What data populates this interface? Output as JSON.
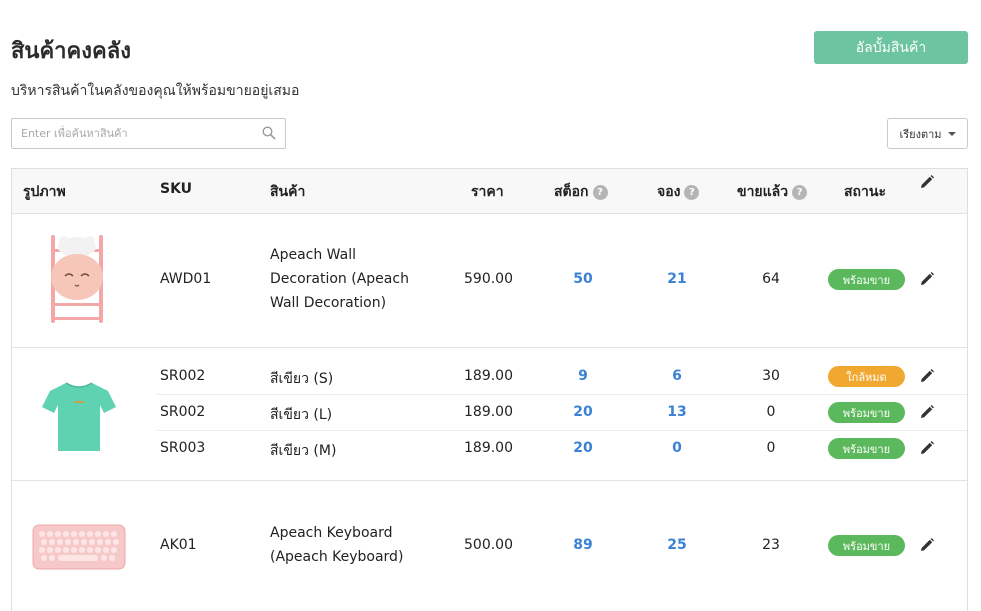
{
  "header": {
    "title": "สินค้าคงคลัง",
    "subtitle": "บริหารสินค้าในคลังของคุณให้พร้อมขายอยู่เสมอ",
    "upload_label": "อัลบั้มสินค้า"
  },
  "search": {
    "placeholder": "Enter เพื่อค้นหาสินค้า",
    "value": ""
  },
  "sort": {
    "label": "เรียงตาม"
  },
  "colors": {
    "accent": "#6cc4a1",
    "link_blue": "#3b82d6",
    "ready": "#5cb85c",
    "low": "#f0a830"
  },
  "table": {
    "columns": {
      "image": "รูปภาพ",
      "sku": "SKU",
      "product": "สินค้า",
      "price": "ราคา",
      "stock": "สต็อก",
      "reserved": "จอง",
      "sold": "ขายแล้ว",
      "status": "สถานะ"
    },
    "products": [
      {
        "image": "apeach-wall-decoration",
        "variants": [
          {
            "sku": "AWD01",
            "name": "Apeach Wall Decoration (Apeach Wall Decoration)",
            "price": "590.00",
            "stock": "50",
            "reserved": "21",
            "sold": "64",
            "status": "พร้อมขาย"
          }
        ]
      },
      {
        "image": "mint-tshirt",
        "variants": [
          {
            "sku": "SR002",
            "name": "สีเขียว (S)",
            "price": "189.00",
            "stock": "9",
            "reserved": "6",
            "sold": "30",
            "status": "ใกล้หมด"
          },
          {
            "sku": "SR002",
            "name": "สีเขียว (L)",
            "price": "189.00",
            "stock": "20",
            "reserved": "13",
            "sold": "0",
            "status": "พร้อมขาย"
          },
          {
            "sku": "SR003",
            "name": "สีเขียว (M)",
            "price": "189.00",
            "stock": "20",
            "reserved": "0",
            "sold": "0",
            "status": "พร้อมขาย"
          }
        ]
      },
      {
        "image": "apeach-keyboard",
        "variants": [
          {
            "sku": "AK01",
            "name": "Apeach Keyboard (Apeach Keyboard)",
            "price": "500.00",
            "stock": "89",
            "reserved": "25",
            "sold": "23",
            "status": "พร้อมขาย"
          }
        ]
      }
    ]
  }
}
